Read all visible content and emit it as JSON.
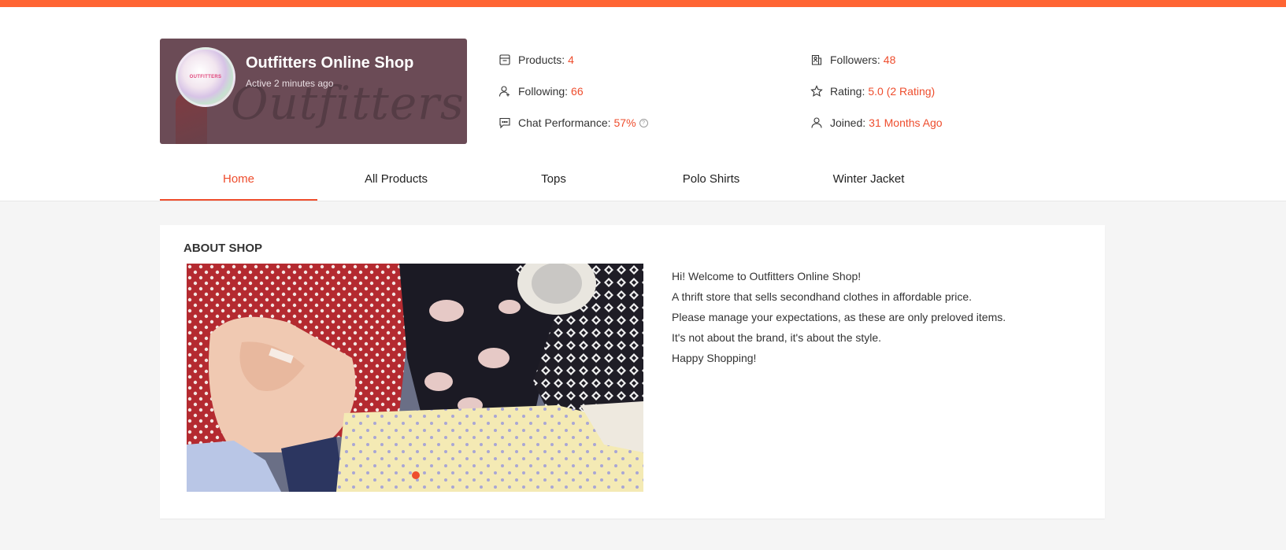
{
  "shop": {
    "name": "Outfitters Online Shop",
    "status": "Active 2 minutes ago",
    "avatar_text": "OUTFITTERS",
    "banner_text": "Outfitters"
  },
  "stats": {
    "products": {
      "label": "Products:",
      "value": "4",
      "icon": "store-icon"
    },
    "followers": {
      "label": "Followers:",
      "value": "48",
      "icon": "followers-icon"
    },
    "following": {
      "label": "Following:",
      "value": "66",
      "icon": "user-add-icon"
    },
    "rating": {
      "label": "Rating:",
      "value": "5.0 (2 Rating)",
      "icon": "star-icon"
    },
    "chat": {
      "label": "Chat Performance:",
      "value": "57%",
      "icon": "chat-icon"
    },
    "joined": {
      "label": "Joined:",
      "value": "31 Months Ago",
      "icon": "user-icon"
    }
  },
  "tabs": [
    {
      "label": "Home",
      "active": true
    },
    {
      "label": "All Products"
    },
    {
      "label": "Tops"
    },
    {
      "label": "Polo Shirts"
    },
    {
      "label": "Winter Jacket"
    }
  ],
  "about": {
    "title": "ABOUT SHOP",
    "lines": [
      "Hi! Welcome to Outfitters Online Shop!",
      "A thrift store that sells secondhand clothes in affordable price.",
      "Please manage your expectations, as these are only preloved items.",
      "It's not about the brand, it's about the style.",
      "Happy Shopping!"
    ]
  },
  "colors": {
    "accent": "#ee4d2d",
    "top_strip": "#ff6533",
    "shop_card": "#6b4b56"
  }
}
